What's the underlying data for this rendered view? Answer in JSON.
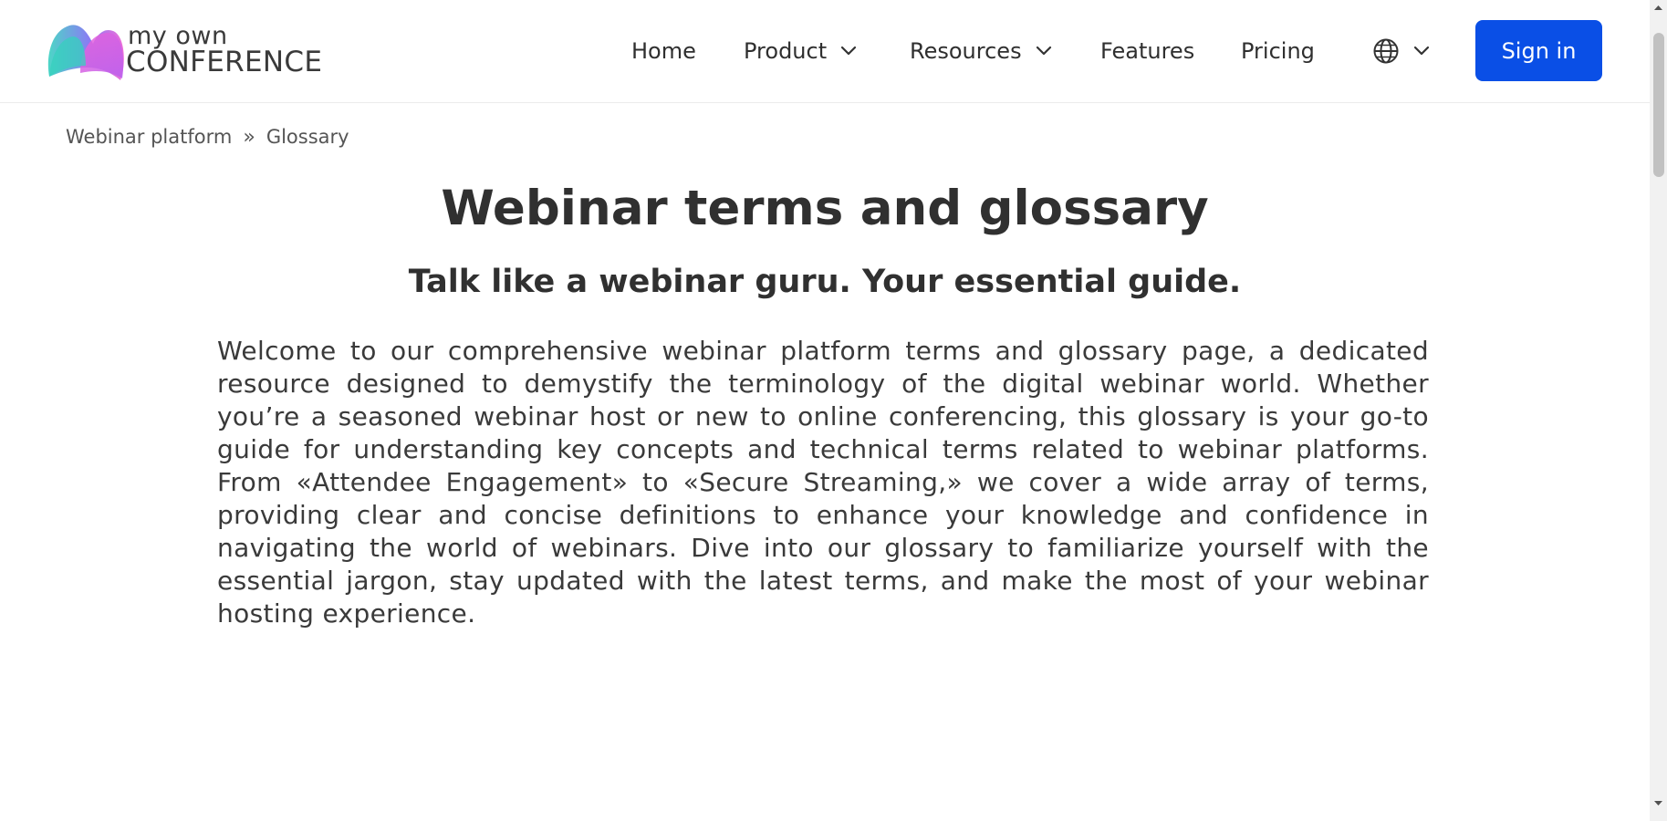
{
  "brand": {
    "line1": "my own",
    "line2": "CONFERENCE",
    "colors": [
      "#3fd0c4",
      "#7b6cf2",
      "#e85fd6"
    ]
  },
  "nav": {
    "home": "Home",
    "product": "Product",
    "resources": "Resources",
    "features": "Features",
    "pricing": "Pricing",
    "language_icon": "globe-icon",
    "signin": "Sign in",
    "signin_color": "#0a4fe6"
  },
  "breadcrumb": {
    "items": [
      "Webinar platform",
      "Glossary"
    ],
    "separator": "»"
  },
  "main": {
    "title": "Webinar terms and glossary",
    "subtitle": "Talk like a webinar guru. Your essential guide.",
    "intro": "Welcome to our comprehensive webinar platform terms and glossary page, a dedicated resource designed to demystify the terminology of the digital webinar world. Whether you’re a seasoned webinar host or new to online conferencing, this glossary is your go-to guide for understanding key concepts and technical terms related to webinar platforms. From «Attendee Engagement» to «Secure Streaming,» we cover a wide array of terms, providing clear and concise definitions to enhance your knowledge and confidence in navigating the world of webinars. Dive into our glossary to familiarize yourself with the essential jargon, stay updated with the latest terms, and make the most of your webinar hosting experience."
  }
}
